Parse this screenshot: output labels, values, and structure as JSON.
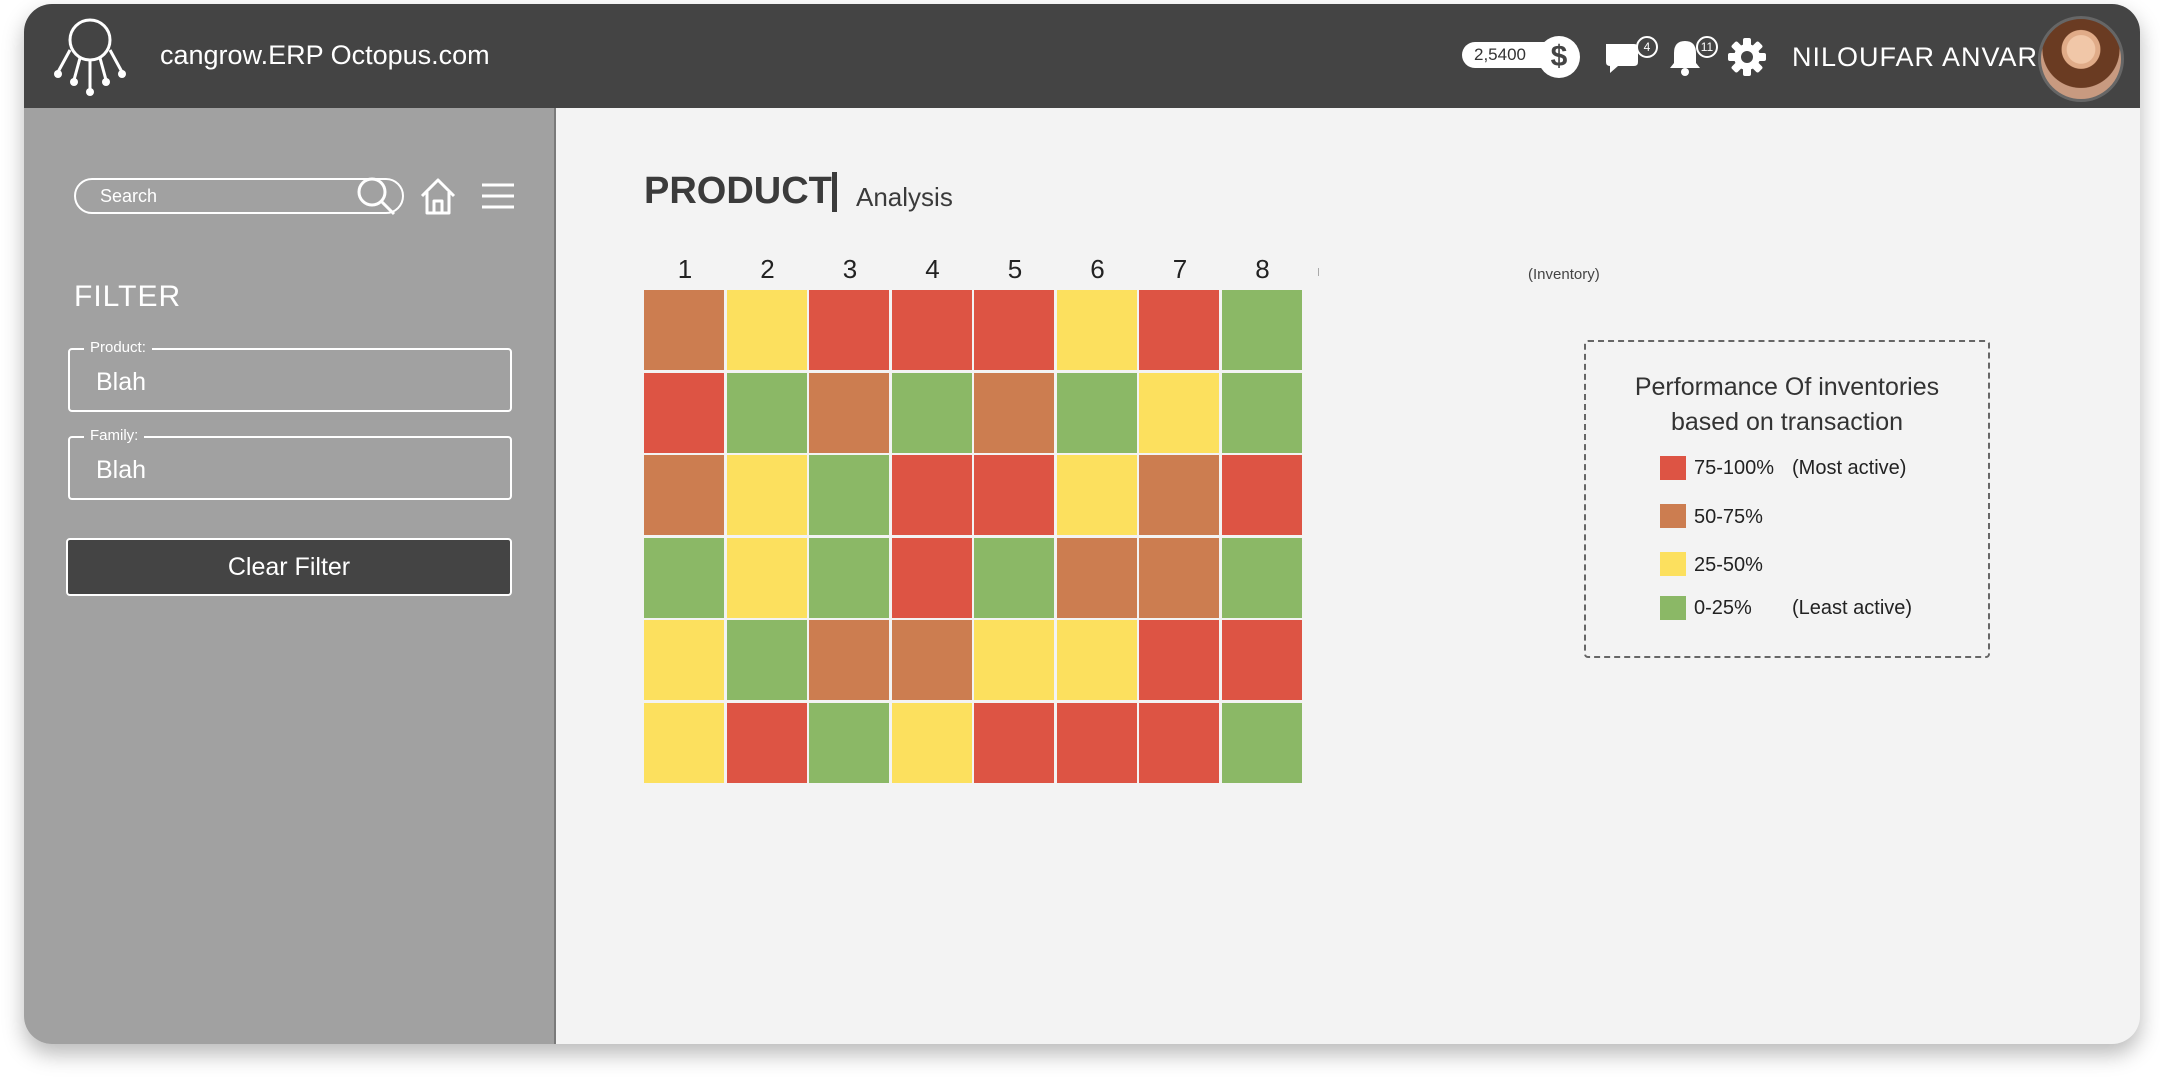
{
  "header": {
    "app_title": "cangrow.ERP Octopus.com",
    "balance": "2,5400",
    "currency_symbol": "$",
    "messages_count": "4",
    "notifications_count": "11",
    "user_name": "NILOUFAR ANVARI",
    "icons": [
      "logo-icon",
      "dollar-icon",
      "chat-icon",
      "bell-icon",
      "gear-icon",
      "avatar"
    ]
  },
  "sidebar": {
    "search_placeholder": "Search",
    "icons": [
      "search-icon",
      "home-icon",
      "menu-icon"
    ],
    "filter_title": "FILTER",
    "fields": [
      {
        "label": "Product:",
        "value": "Blah"
      },
      {
        "label": "Family:",
        "value": "Blah"
      }
    ],
    "clear_button": "Clear Filter"
  },
  "main": {
    "title": "PRODUCT",
    "subtitle": "Analysis"
  },
  "chart_data": {
    "type": "heatmap",
    "columns": [
      "1",
      "2",
      "3",
      "4",
      "5",
      "6",
      "7",
      "8"
    ],
    "x_axis_label": "(Inventory)",
    "cells": [
      [
        "50-75%",
        "25-50%",
        "75-100%",
        "75-100%",
        "75-100%",
        "25-50%",
        "75-100%",
        "0-25%"
      ],
      [
        "75-100%",
        "0-25%",
        "50-75%",
        "0-25%",
        "50-75%",
        "0-25%",
        "25-50%",
        "0-25%"
      ],
      [
        "50-75%",
        "25-50%",
        "0-25%",
        "75-100%",
        "75-100%",
        "25-50%",
        "50-75%",
        "75-100%"
      ],
      [
        "0-25%",
        "25-50%",
        "0-25%",
        "75-100%",
        "0-25%",
        "50-75%",
        "50-75%",
        "0-25%"
      ],
      [
        "25-50%",
        "0-25%",
        "50-75%",
        "50-75%",
        "25-50%",
        "25-50%",
        "75-100%",
        "75-100%"
      ],
      [
        "25-50%",
        "75-100%",
        "0-25%",
        "25-50%",
        "75-100%",
        "75-100%",
        "75-100%",
        "0-25%"
      ]
    ],
    "legend": {
      "title_line1": "Performance Of inventories",
      "title_line2": "based on transaction",
      "items": [
        {
          "range": "75-100%",
          "description": "(Most active)",
          "color": "#dd5444"
        },
        {
          "range": "50-75%",
          "description": "",
          "color": "#cc7d50"
        },
        {
          "range": "25-50%",
          "description": "",
          "color": "#fce05e"
        },
        {
          "range": "0-25%",
          "description": "(Least active)",
          "color": "#8bb866"
        }
      ]
    }
  }
}
